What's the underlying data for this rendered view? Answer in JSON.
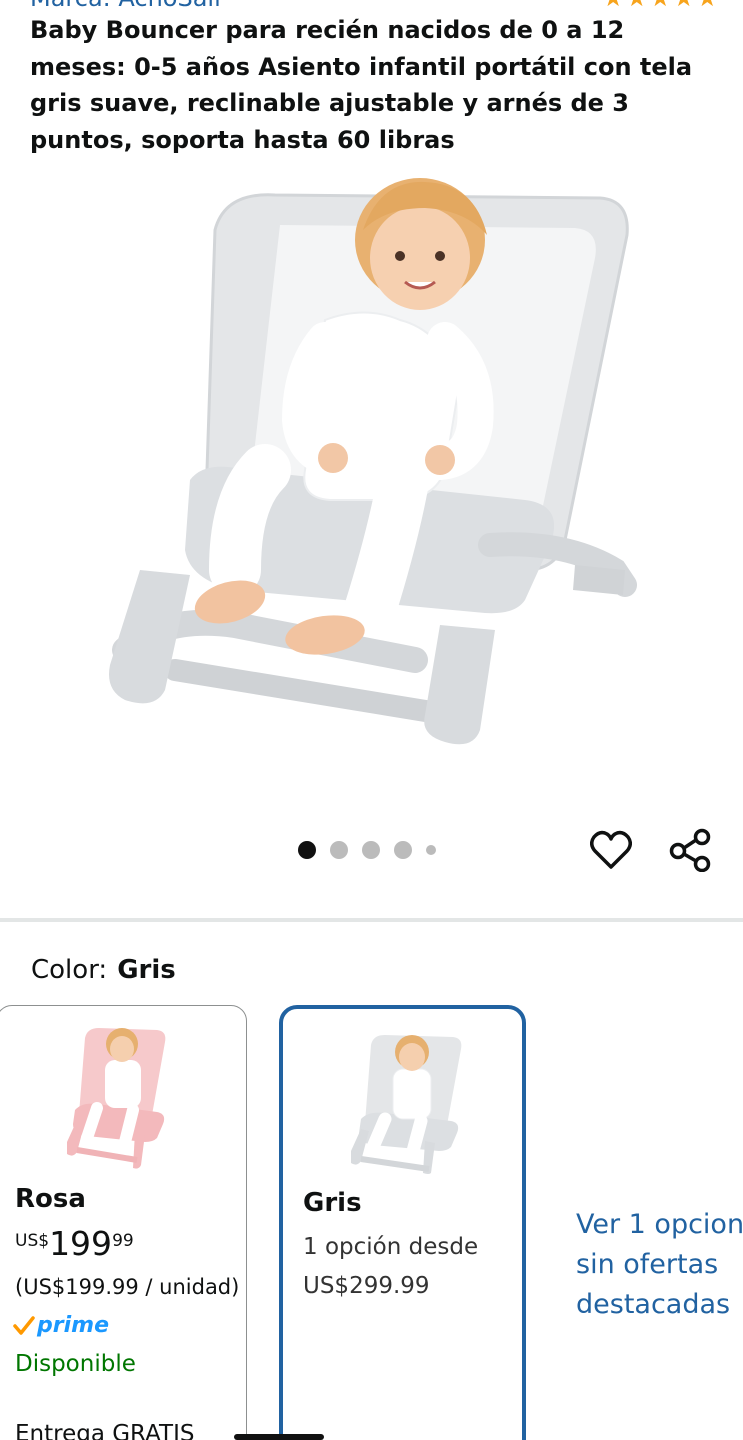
{
  "top": {
    "brand_fragment": "Marca: AchoSail",
    "stars": "★★★★★"
  },
  "product": {
    "title": "Baby Bouncer para recién nacidos de 0 a 12 meses: 0-5 años Asiento infantil portátil con tela gris suave, reclinable ajustable y arnés de 3 puntos, soporta hasta 60 libras"
  },
  "gallery": {
    "image_count": 5,
    "active_index": 0
  },
  "actions": {
    "favorite_icon": "heart-icon",
    "share_icon": "share-icon"
  },
  "color_selector": {
    "label": "Color:",
    "selected": "Gris",
    "options": [
      {
        "name": "Rosa",
        "price_currency": "US$",
        "price_whole": "199",
        "price_fraction": "99",
        "unit_price": "(US$199.99 / unidad)",
        "prime_check": "✓",
        "prime_label": "prime",
        "availability": "Disponible",
        "delivery": "Entrega GRATIS"
      },
      {
        "name": "Gris",
        "from_label": "1 opción desde",
        "from_price": "US$299.99"
      }
    ],
    "more_link": "Ver 1 opcion sin ofertas destacadas"
  },
  "colors": {
    "link": "#2162a1",
    "prime": "#1a98ff",
    "prime_check": "#ff9900",
    "available": "#007600",
    "selected_border": "#2162a1",
    "stars": "#f7a41d"
  }
}
